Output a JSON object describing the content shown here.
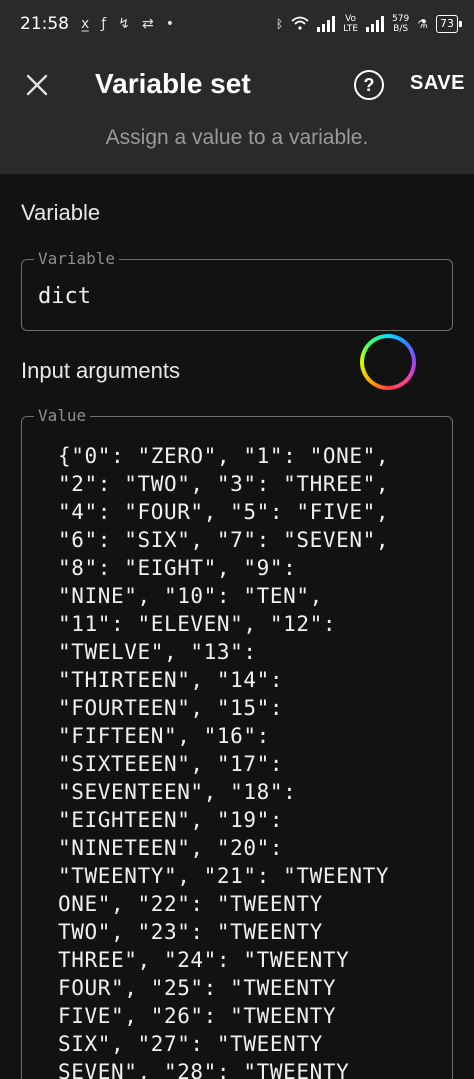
{
  "status_bar": {
    "time": "21:58",
    "network_speed_value": "579",
    "network_speed_unit": "B/S",
    "lte_label_top": "Vo",
    "lte_label_bottom": "LTE",
    "battery": "73"
  },
  "app_bar": {
    "title": "Variable set",
    "subtitle": "Assign a value to a variable.",
    "help_label": "?",
    "save_label": "SAVE"
  },
  "variable_section": {
    "heading": "Variable",
    "field_label": "Variable",
    "field_value": "dict"
  },
  "input_section": {
    "heading": "Input arguments",
    "field_label": "Value",
    "field_value": "{\"0\": \"ZERO\", \"1\": \"ONE\",\n\"2\": \"TWO\", \"3\": \"THREE\",\n\"4\": \"FOUR\", \"5\": \"FIVE\",\n\"6\": \"SIX\", \"7\": \"SEVEN\",\n\"8\": \"EIGHT\", \"9\":\n\"NINE\", \"10\": \"TEN\",\n\"11\": \"ELEVEN\", \"12\":\n\"TWELVE\", \"13\":\n\"THIRTEEN\", \"14\":\n\"FOURTEEN\", \"15\":\n\"FIFTEEN\", \"16\":\n\"SIXTEEEN\", \"17\":\n\"SEVENTEEN\", \"18\":\n\"EIGHTEEN\", \"19\":\n\"NINETEEN\", \"20\":\n\"TWEENTY\", \"21\": \"TWEENTY\nONE\", \"22\": \"TWEENTY\nTWO\", \"23\": \"TWEENTY\nTHREE\", \"24\": \"TWEENTY\nFOUR\", \"25\": \"TWEENTY\nFIVE\", \"26\": \"TWEENTY\nSIX\", \"27\": \"TWEENTY\nSEVEN\", \"28\": \"TWEENTY"
  },
  "icons": {
    "close": "close-icon",
    "help": "help-circle-icon",
    "color_picker": "color-wheel-icon"
  }
}
